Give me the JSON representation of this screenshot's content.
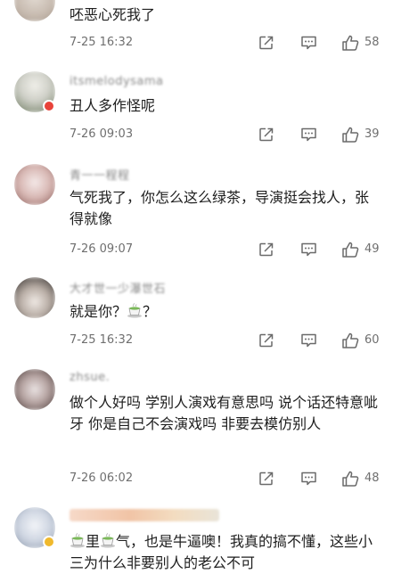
{
  "comments": [
    {
      "username": "",
      "text": "呸恶心死我了",
      "time": "7-25 16:32",
      "likes": "58",
      "avatar_colors": [
        "#d8d0c8",
        "#b9aaa0"
      ]
    },
    {
      "username": "itsmelodysama",
      "text": "丑人多作怪呢",
      "time": "7-26 09:03",
      "likes": "39",
      "avatar_colors": [
        "#d9dad4",
        "#6b7a5e"
      ],
      "badge": "red"
    },
    {
      "username": "青一一程程",
      "text": "气死我了，你怎么这么绿茶，导演挺会找人，张得就像",
      "time": "7-26 09:07",
      "likes": "49",
      "avatar_colors": [
        "#f2e6e6",
        "#b88a84"
      ]
    },
    {
      "username": "大才世一少瀑世石",
      "text_before": "就是你？",
      "text_after": "？",
      "time": "7-25 16:32",
      "likes": "60",
      "avatar_colors": [
        "#e6e2de",
        "#3a3634"
      ]
    },
    {
      "username": "zhsue.",
      "text": "做个人好吗 学别人演戏有意思吗 说个话还特意呲牙 你是自己不会演戏吗 非要去模仿别人",
      "time": "7-26 06:02",
      "likes": "48",
      "avatar_colors": [
        "#dcd4d4",
        "#5a4a48"
      ]
    },
    {
      "username": "",
      "text_seg1": "里",
      "text_seg2": "气，也是牛逼噢！我真的搞不懂，这些小三为什么非要别人的老公不可",
      "time": "",
      "likes": "",
      "avatar_colors": [
        "#e8ecf2",
        "#9aa6b8"
      ],
      "badge": "gold"
    }
  ],
  "icons": {
    "share": "share-icon",
    "reply": "comment-icon",
    "like": "thumbs-up-icon",
    "emoji": "tea-emoji-icon"
  },
  "colors": {
    "text": "#1e1e1e",
    "meta": "#6f6f6f",
    "username": "#888888",
    "background": "#ffffff"
  }
}
